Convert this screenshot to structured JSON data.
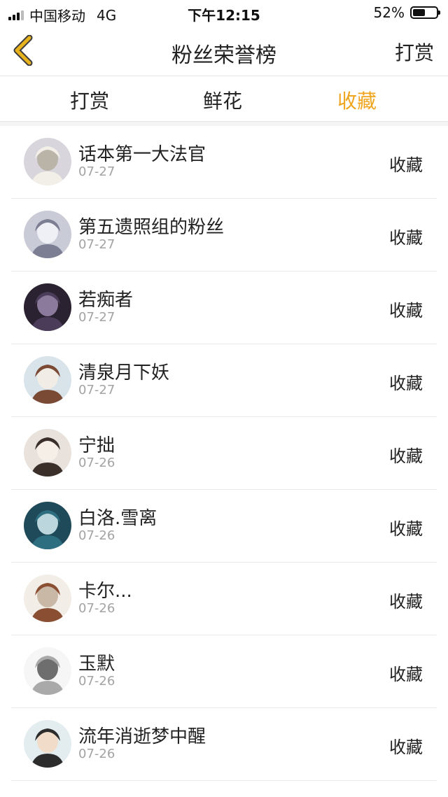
{
  "status_bar": {
    "carrier": "中国移动",
    "network": "4G",
    "time": "下午12:15",
    "battery_text": "52%",
    "battery_level": 0.52
  },
  "nav": {
    "back_icon": "chevron-left-icon",
    "title": "粉丝荣誉榜",
    "right_action": "打赏"
  },
  "tabs": [
    {
      "label": "打赏",
      "active": false
    },
    {
      "label": "鲜花",
      "active": false
    },
    {
      "label": "收藏",
      "active": true
    }
  ],
  "colors": {
    "accent": "#f0a51e",
    "back_icon": "#e8b21c"
  },
  "fans": [
    {
      "name": "话本第一大法官",
      "date": "07-27",
      "action": "收藏"
    },
    {
      "name": "第五遗照组的粉丝",
      "date": "07-27",
      "action": "收藏"
    },
    {
      "name": "若痴者",
      "date": "07-27",
      "action": "收藏"
    },
    {
      "name": "清泉月下妖",
      "date": "07-27",
      "action": "收藏"
    },
    {
      "name": "宁拙",
      "date": "07-26",
      "action": "收藏"
    },
    {
      "name": "白洛.雪离",
      "date": "07-26",
      "action": "收藏"
    },
    {
      "name": "卡尔...",
      "date": "07-26",
      "action": "收藏"
    },
    {
      "name": "玉默",
      "date": "07-26",
      "action": "收藏"
    },
    {
      "name": "流年消逝梦中醒",
      "date": "07-26",
      "action": "收藏"
    }
  ]
}
